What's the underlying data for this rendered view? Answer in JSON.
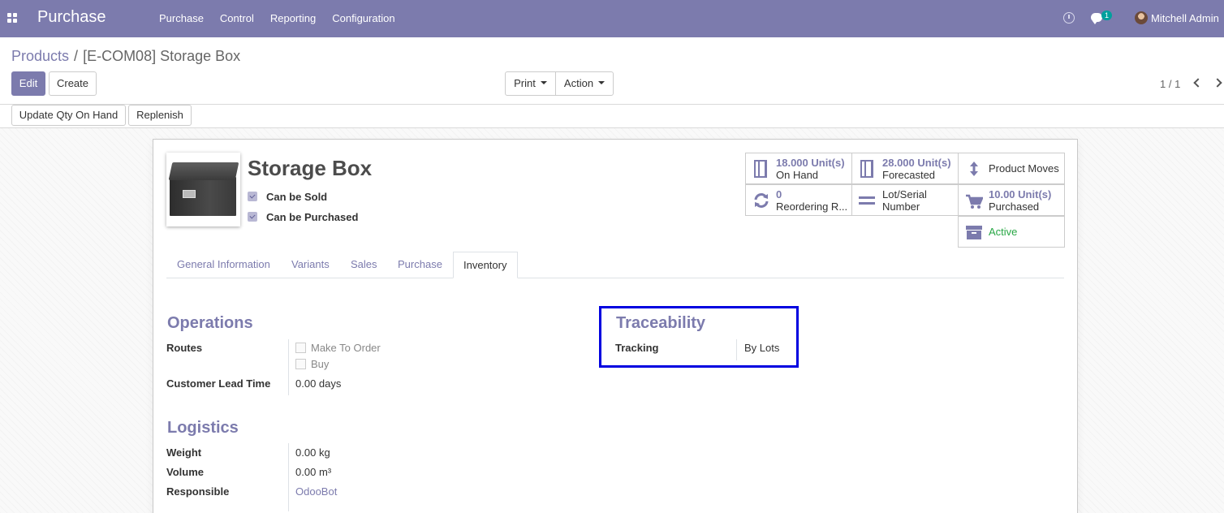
{
  "navbar": {
    "brand": "Purchase",
    "menu": [
      "Purchase",
      "Control",
      "Reporting",
      "Configuration"
    ],
    "chat_badge": "1",
    "user_name": "Mitchell Admin"
  },
  "breadcrumb": {
    "parent": "Products",
    "separator": "/",
    "current": "[E-COM08] Storage Box"
  },
  "buttons": {
    "edit": "Edit",
    "create": "Create",
    "print": "Print",
    "action": "Action",
    "update_qty": "Update Qty On Hand",
    "replenish": "Replenish"
  },
  "pager": {
    "value": "1 / 1"
  },
  "product": {
    "name": "Storage Box",
    "can_be_sold": "Can be Sold",
    "can_be_purchased": "Can be Purchased"
  },
  "smart_buttons": {
    "on_hand": {
      "value": "18.000",
      "unit": "Unit(s)",
      "label": "On Hand"
    },
    "forecasted": {
      "value": "28.000",
      "unit": "Unit(s)",
      "label": "Forecasted"
    },
    "product_moves": {
      "label": "Product Moves"
    },
    "reordering": {
      "value": "0",
      "label": "Reordering R..."
    },
    "lot_serial": {
      "line1": "Lot/Serial",
      "line2": "Number"
    },
    "purchased": {
      "value": "10.00",
      "unit": "Unit(s)",
      "label": "Purchased"
    },
    "active": {
      "label": "Active"
    }
  },
  "tabs": [
    "General Information",
    "Variants",
    "Sales",
    "Purchase",
    "Inventory"
  ],
  "operations": {
    "title": "Operations",
    "routes_label": "Routes",
    "routes": [
      "Make To Order",
      "Buy"
    ],
    "lead_time_label": "Customer Lead Time",
    "lead_time_value": "0.00 days"
  },
  "traceability": {
    "title": "Traceability",
    "tracking_label": "Tracking",
    "tracking_value": "By Lots"
  },
  "logistics": {
    "title": "Logistics",
    "weight_label": "Weight",
    "weight_value": "0.00",
    "weight_unit": "kg",
    "volume_label": "Volume",
    "volume_value": "0.00",
    "volume_unit": "m³",
    "responsible_label": "Responsible",
    "responsible_value": "OdooBot"
  },
  "colors": {
    "brand": "#7c7bad",
    "active": "#28a745",
    "highlight": "#0000e0"
  }
}
